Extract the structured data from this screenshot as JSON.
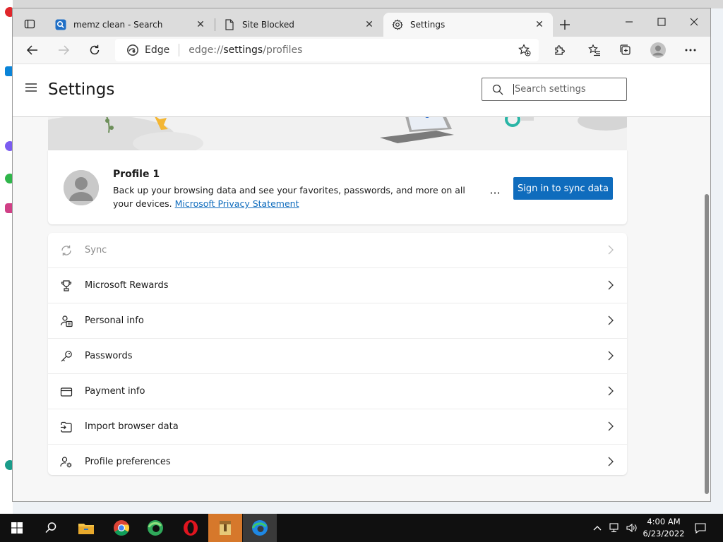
{
  "browser": {
    "tabs": [
      {
        "label": "memz clean - Search",
        "icon": "search-icon",
        "active": false
      },
      {
        "label": "Site Blocked",
        "icon": "page-icon",
        "active": false
      },
      {
        "label": "Settings",
        "icon": "gear-icon",
        "active": true
      }
    ],
    "address": {
      "brand": "Edge",
      "url_prefix": "edge://",
      "url_main": "settings",
      "url_suffix": "/profiles"
    }
  },
  "settings": {
    "title": "Settings",
    "search_placeholder": "Search settings"
  },
  "profile": {
    "name": "Profile 1",
    "description": "Back up your browsing data and see your favorites, passwords, and more on all your devices.",
    "privacy_link": "Microsoft Privacy Statement",
    "more_label": "···",
    "sign_in_label": "Sign in to sync data"
  },
  "menu_items": [
    {
      "label": "Sync",
      "icon": "sync-icon",
      "disabled": true
    },
    {
      "label": "Microsoft Rewards",
      "icon": "trophy-icon",
      "disabled": false
    },
    {
      "label": "Personal info",
      "icon": "personal-info-icon",
      "disabled": false
    },
    {
      "label": "Passwords",
      "icon": "key-icon",
      "disabled": false
    },
    {
      "label": "Payment info",
      "icon": "credit-card-icon",
      "disabled": false
    },
    {
      "label": "Import browser data",
      "icon": "import-icon",
      "disabled": false
    },
    {
      "label": "Profile preferences",
      "icon": "profile-preferences-icon",
      "disabled": false
    }
  ],
  "taskbar": {
    "time": "4:00 AM",
    "date": "6/23/2022"
  },
  "colors": {
    "accent": "#0f6cbd",
    "taskbar": "#101010"
  }
}
